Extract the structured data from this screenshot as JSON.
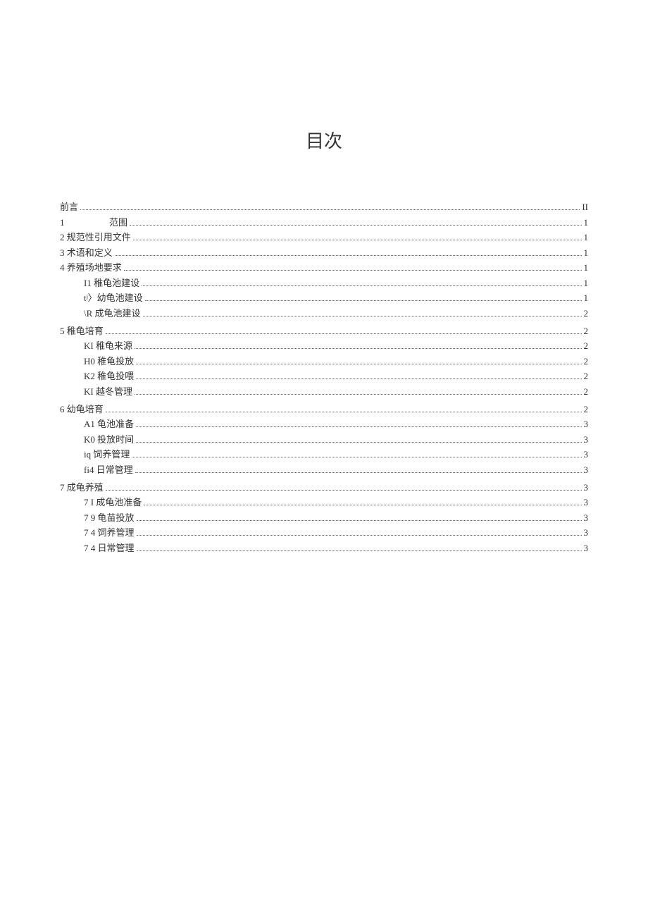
{
  "title": "目次",
  "toc": {
    "preface": {
      "label": "前言",
      "page": "II"
    },
    "s1": {
      "num": "1",
      "label": "范围",
      "page": "1"
    },
    "s2": {
      "label": "2 规范性引用文件",
      "page": "1"
    },
    "s3": {
      "label": "3 术语和定义",
      "page": "1"
    },
    "s4": {
      "label": "4 养殖场地要求",
      "page": "1"
    },
    "s4_1": {
      "label": "I1 稚龟池建设",
      "page": "1"
    },
    "s4_2": {
      "label": "tʲ〉幼龟池建设",
      "page": "1"
    },
    "s4_3": {
      "label": "\\R 成龟池建设",
      "page": "2"
    },
    "s5": {
      "label": "5 稚龟培育",
      "page": "2"
    },
    "s5_1": {
      "label": "KI 稚龟来源",
      "page": "2"
    },
    "s5_2": {
      "label": "H0 稚龟投放",
      "page": "2"
    },
    "s5_3": {
      "label": "K2 稚龟投喂",
      "page": "2"
    },
    "s5_4": {
      "label": "KI 越冬管理",
      "page": "2"
    },
    "s6": {
      "label": "6 幼龟培育",
      "page": "2"
    },
    "s6_1": {
      "label": "A1 龟池准备",
      "page": "3"
    },
    "s6_2": {
      "label": "K0 投放时间",
      "page": "3"
    },
    "s6_3": {
      "label": "iq 饲养管理",
      "page": "3"
    },
    "s6_4": {
      "label": "fi4 日常管理",
      "page": "3"
    },
    "s7": {
      "label": "7 成龟养殖",
      "page": "3"
    },
    "s7_1": {
      "label": "7   I 成龟池准备",
      "page": "3"
    },
    "s7_2": {
      "label": "7   9 龟苗投放",
      "page": "3"
    },
    "s7_3": {
      "label": "7   4 饲养管理",
      "page": "3"
    },
    "s7_4": {
      "label": "7   4 日常管理",
      "page": "3"
    }
  }
}
